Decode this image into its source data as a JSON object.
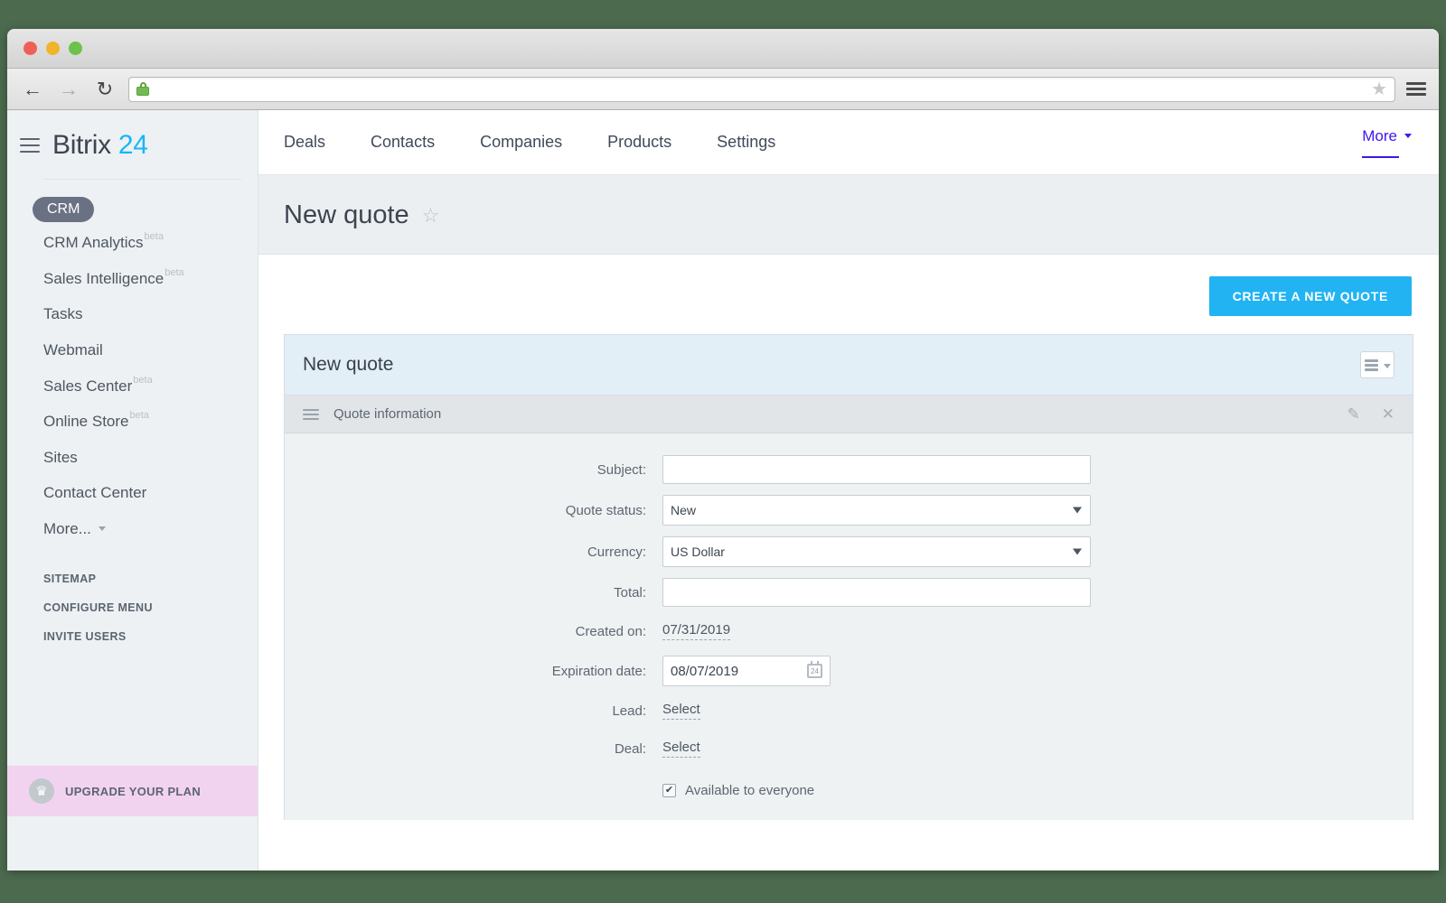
{
  "browser": {
    "back_icon": "arrow-left-icon",
    "forward_icon": "arrow-right-icon",
    "reload_icon": "reload-icon",
    "lock_icon": "lock-icon",
    "url": "",
    "url_placeholder": "",
    "bookmark_icon": "star-icon",
    "menu_icon": "hamburger-menu-icon"
  },
  "sidebar": {
    "menu_icon": "hamburger-menu-icon",
    "brand_name": "Bitrix",
    "brand_number": "24",
    "items": [
      {
        "label": "CRM",
        "beta": "",
        "pill": true
      },
      {
        "label": "CRM Analytics",
        "beta": "beta",
        "pill": false
      },
      {
        "label": "Sales Intelligence",
        "beta": "beta",
        "pill": false
      },
      {
        "label": "Tasks",
        "beta": "",
        "pill": false
      },
      {
        "label": "Webmail",
        "beta": "",
        "pill": false
      },
      {
        "label": "Sales Center",
        "beta": "beta",
        "pill": false
      },
      {
        "label": "Online Store",
        "beta": "beta",
        "pill": false
      },
      {
        "label": "Sites",
        "beta": "",
        "pill": false
      },
      {
        "label": "Contact Center",
        "beta": "",
        "pill": false
      },
      {
        "label": "More...",
        "beta": "",
        "pill": false,
        "caret": true
      }
    ],
    "small_links": [
      "SITEMAP",
      "CONFIGURE MENU",
      "INVITE USERS"
    ],
    "upgrade": {
      "label": "UPGRADE YOUR PLAN",
      "icon": "crown-icon"
    }
  },
  "topnav": {
    "items": [
      "Deals",
      "Contacts",
      "Companies",
      "Products",
      "Settings"
    ],
    "more_label": "More"
  },
  "page": {
    "title": "New quote",
    "favorite_icon": "star-outline-icon",
    "create_button": "CREATE A NEW QUOTE"
  },
  "card": {
    "title": "New quote",
    "view_button_icon": "list-view-icon",
    "section": {
      "drag_icon": "drag-handle-icon",
      "title": "Quote information",
      "edit_icon": "pencil-icon",
      "close_icon": "close-icon"
    }
  },
  "form": {
    "fields": [
      {
        "label": "Subject:",
        "type": "text",
        "value": "",
        "name": "subject"
      },
      {
        "label": "Quote status:",
        "type": "select",
        "value": "New",
        "name": "quote-status"
      },
      {
        "label": "Currency:",
        "type": "select",
        "value": "US Dollar",
        "name": "currency"
      },
      {
        "label": "Total:",
        "type": "text",
        "value": "",
        "name": "total"
      },
      {
        "label": "Created on:",
        "type": "dotted",
        "value": "07/31/2019",
        "name": "created-on"
      },
      {
        "label": "Expiration date:",
        "type": "date",
        "value": "08/07/2019",
        "name": "expiration-date"
      },
      {
        "label": "Lead:",
        "type": "dotted",
        "value": "Select",
        "name": "lead"
      },
      {
        "label": "Deal:",
        "type": "dotted",
        "value": "Select",
        "name": "deal"
      }
    ],
    "checkbox": {
      "label": "Available to everyone",
      "checked": true,
      "mark": "✔"
    }
  },
  "colors": {
    "accent_blue": "#22b3f3",
    "brand_blue": "#19b5f6",
    "more_purple": "#3f17e8",
    "upgrade_pink": "#f2d3ef",
    "card_head_blue": "#e3eff6",
    "desktop_green": "#4c6b4e"
  }
}
